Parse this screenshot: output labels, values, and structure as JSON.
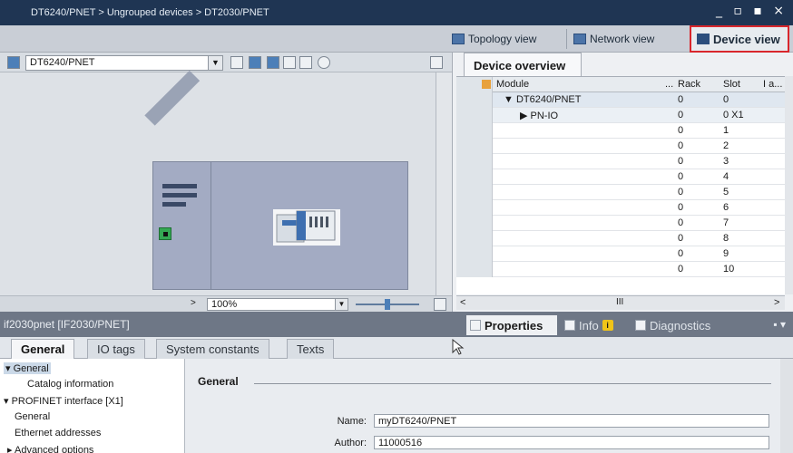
{
  "window": {
    "breadcrumb": "DT6240/PNET > Ungrouped devices > DT2030/PNET",
    "controls": "_ ▫ ▪ ×"
  },
  "view_tabs": {
    "topology": "Topology view",
    "network": "Network view",
    "device": "Device view"
  },
  "toolbar": {
    "device_selector": "DT6240/PNET",
    "zoom_value": "100%"
  },
  "overview": {
    "tab_label": "Device overview",
    "columns": [
      "Module",
      "...",
      "Rack",
      "Slot",
      "I a..."
    ],
    "rows": [
      {
        "module": "▼  DT6240/PNET",
        "rack": "0",
        "slot": "0"
      },
      {
        "module": "▶  PN-IO",
        "rack": "0",
        "slot": "0 X1"
      },
      {
        "module": "",
        "rack": "0",
        "slot": "1"
      },
      {
        "module": "",
        "rack": "0",
        "slot": "2"
      },
      {
        "module": "",
        "rack": "0",
        "slot": "3"
      },
      {
        "module": "",
        "rack": "0",
        "slot": "4"
      },
      {
        "module": "",
        "rack": "0",
        "slot": "5"
      },
      {
        "module": "",
        "rack": "0",
        "slot": "6"
      },
      {
        "module": "",
        "rack": "0",
        "slot": "7"
      },
      {
        "module": "",
        "rack": "0",
        "slot": "8"
      },
      {
        "module": "",
        "rack": "0",
        "slot": "9"
      },
      {
        "module": "",
        "rack": "0",
        "slot": "10"
      }
    ]
  },
  "properties": {
    "title": "if2030pnet [IF2030/PNET]",
    "tabs": {
      "properties": "Properties",
      "info": "Info",
      "info_badge": "i",
      "diagnostics": "Diagnostics"
    },
    "subtabs": [
      "General",
      "IO tags",
      "System constants",
      "Texts"
    ],
    "nav": [
      "General",
      "Catalog information",
      "PROFINET interface [X1]",
      "General",
      "Ethernet addresses",
      "Advanced options"
    ],
    "form": {
      "section": "General",
      "name_label": "Name:",
      "name_value": "myDT6240/PNET",
      "author_label": "Author:",
      "author_value": "11000516"
    }
  },
  "colors": {
    "titlebar": "#1f3553",
    "highlight_border": "#d9262c",
    "device_body": "#a3abc3",
    "port_green": "#34a853"
  }
}
